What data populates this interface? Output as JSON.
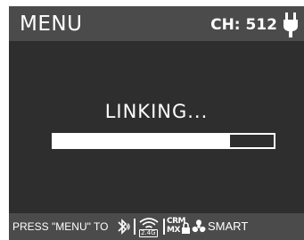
{
  "header": {
    "title": "MENU",
    "channel": "CH: 512",
    "power_icon": "plug-icon"
  },
  "main": {
    "status": "LINKING...",
    "progress": 0.8
  },
  "footer": {
    "hint": "PRESS \"MENU\" TO",
    "wireless_badge": "2.4G",
    "crmx_label_top": "CRM",
    "crmx_label_bottom": "MX",
    "smart_label": "SMART",
    "icons": [
      "bluetooth-icon",
      "wifi-2.4g-icon",
      "crmx-icon",
      "lock-icon",
      "fan-icon"
    ]
  },
  "colors": {
    "header_bg": "#4b4b4b",
    "screen_bg": "#2e2e2e",
    "foreground": "#ffffff"
  }
}
